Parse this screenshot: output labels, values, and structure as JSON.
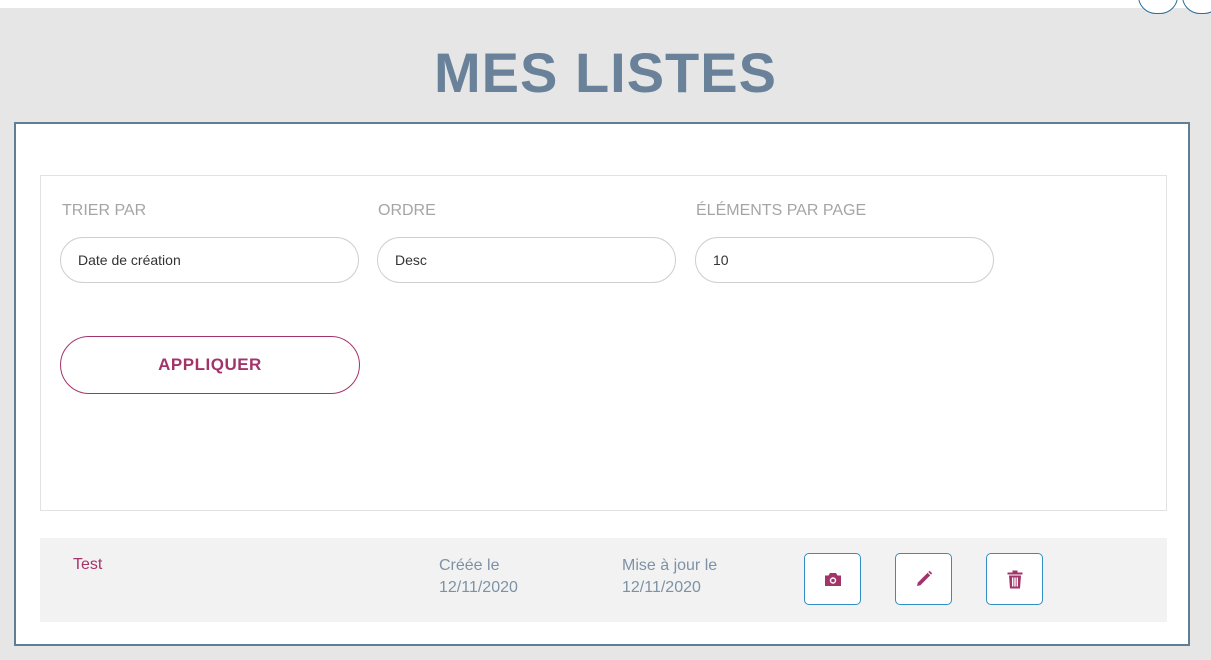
{
  "page": {
    "title": "MES LISTES"
  },
  "filters": {
    "sort_by": {
      "label": "TRIER PAR",
      "value": "Date de création"
    },
    "order": {
      "label": "ORDRE",
      "value": "Desc"
    },
    "per_page": {
      "label": "ÉLÉMENTS PAR PAGE",
      "value": "10"
    },
    "apply_label": "APPLIQUER"
  },
  "lists": [
    {
      "name": "Test",
      "created_label": "Créée le",
      "created_date": "12/11/2020",
      "updated_label": "Mise à jour le",
      "updated_date": "12/11/2020",
      "actions": [
        {
          "icon": "camera-icon"
        },
        {
          "icon": "pencil-icon"
        },
        {
          "icon": "trash-icon"
        }
      ]
    }
  ],
  "colors": {
    "title": "#6a8299",
    "accent": "#a3346a",
    "panel_border": "#5f7d93",
    "action_border": "#2f8fc4",
    "meta_text": "#7d92a6"
  }
}
